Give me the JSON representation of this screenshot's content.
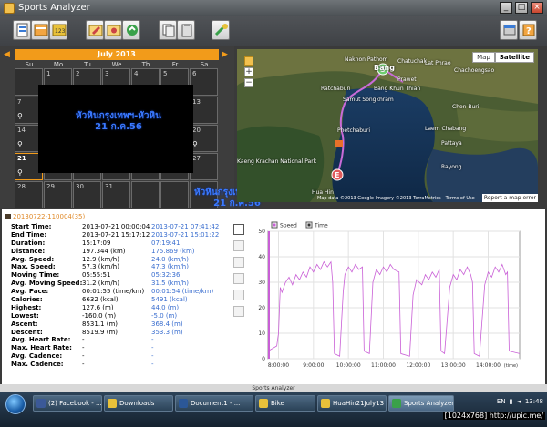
{
  "window": {
    "title": "Sports Analyzer",
    "controls": [
      "_",
      "□",
      "×"
    ]
  },
  "toolbar": {
    "buttons": [
      "new-icon",
      "import-icon",
      "export-icon",
      "edit-icon",
      "gear-icon",
      "refresh-icon",
      "copy-icon",
      "paste-icon",
      "plugin-icon",
      "pin-icon",
      "help-icon"
    ]
  },
  "calendar": {
    "month_label": "July 2013",
    "prev": "◀",
    "next": "▶",
    "weekdays": [
      "Su",
      "Mo",
      "Tu",
      "We",
      "Th",
      "Fr",
      "Sa"
    ],
    "days": [
      {
        "n": "",
        "bike": false
      },
      {
        "n": "1",
        "bike": false
      },
      {
        "n": "2",
        "bike": false
      },
      {
        "n": "3",
        "bike": false
      },
      {
        "n": "4",
        "bike": false
      },
      {
        "n": "5",
        "bike": false
      },
      {
        "n": "6",
        "bike": false
      },
      {
        "n": "7",
        "bike": true
      },
      {
        "n": "8",
        "bike": false
      },
      {
        "n": "9",
        "bike": false
      },
      {
        "n": "10",
        "bike": false
      },
      {
        "n": "11",
        "bike": false
      },
      {
        "n": "12",
        "bike": false
      },
      {
        "n": "13",
        "bike": false
      },
      {
        "n": "14",
        "bike": true
      },
      {
        "n": "15",
        "bike": false
      },
      {
        "n": "16",
        "bike": false
      },
      {
        "n": "17",
        "bike": false
      },
      {
        "n": "18",
        "bike": false
      },
      {
        "n": "19",
        "bike": false
      },
      {
        "n": "20",
        "bike": true
      },
      {
        "n": "21",
        "bike": true,
        "selected": true
      },
      {
        "n": "22",
        "bike": false
      },
      {
        "n": "23",
        "bike": false
      },
      {
        "n": "24",
        "bike": false
      },
      {
        "n": "25",
        "bike": false
      },
      {
        "n": "26",
        "bike": false
      },
      {
        "n": "27",
        "bike": false
      },
      {
        "n": "28",
        "bike": false
      },
      {
        "n": "29",
        "bike": false
      },
      {
        "n": "30",
        "bike": false
      },
      {
        "n": "31",
        "bike": false
      },
      {
        "n": "",
        "bike": false
      },
      {
        "n": "",
        "bike": false
      },
      {
        "n": "",
        "bike": false
      }
    ],
    "overlay_text_1": "หัวหินกรุงเทพฯ-หัวหิน",
    "overlay_date_1": "21 ก.ค.56",
    "overlay_text_2": "หัวหินกรุงเทพฯ-หัวหิน",
    "overlay_date_2": "21 ก.ค.56"
  },
  "map": {
    "type_buttons": [
      "Map",
      "Satellite"
    ],
    "active_type": "Satellite",
    "zoom_in": "+",
    "zoom_out": "−",
    "places": [
      {
        "name": "Nakhon Pathom",
        "big": false
      },
      {
        "name": "Bang",
        "big": true
      },
      {
        "name": "Chatuchak",
        "big": false
      },
      {
        "name": "Lat Phrao",
        "big": false
      },
      {
        "name": "Chachoengsao",
        "big": false
      },
      {
        "name": "Ratchaburi",
        "big": false
      },
      {
        "name": "Prawet",
        "big": false
      },
      {
        "name": "Bang Khun Thian",
        "big": false
      },
      {
        "name": "Samut Songkhram",
        "big": false
      },
      {
        "name": "Chon Buri",
        "big": false
      },
      {
        "name": "Kaeng Krachan National Park",
        "big": false
      },
      {
        "name": "Laem Chabang",
        "big": false
      },
      {
        "name": "Phetchaburi",
        "big": false
      },
      {
        "name": "Pattaya",
        "big": false
      },
      {
        "name": "Rayong",
        "big": false
      },
      {
        "name": "Hua Hin",
        "big": false
      }
    ],
    "marker_start": "S",
    "marker_end": "E",
    "footer": "Map data ©2013 Google Imagery ©2013 TerraMetrics - Terms of Use",
    "report": "Report a map error",
    "route_color": "#c96bd8"
  },
  "activity": {
    "id": "20130722-110004(35)",
    "stats": [
      {
        "k": "Start Time:",
        "v": "2013-07-21 00:00:04",
        "v2": "2013-07-21 07:41:42"
      },
      {
        "k": "End Time:",
        "v": "2013-07-21 15:17:12",
        "v2": "2013-07-21 15:01:22"
      },
      {
        "k": "Duration:",
        "v": "15:17:09",
        "v2": "07:19:41"
      },
      {
        "k": "Distance:",
        "v": "197.344 (km)",
        "v2": "175.869 (km)"
      },
      {
        "k": "Avg. Speed:",
        "v": "12.9 (km/h)",
        "v2": "24.0 (km/h)"
      },
      {
        "k": "Max. Speed:",
        "v": "57.3 (km/h)",
        "v2": "47.3 (km/h)"
      },
      {
        "k": "Moving Time:",
        "v": "05:55:51",
        "v2": "05:32:36"
      },
      {
        "k": "Avg. Moving Speed:",
        "v": "31.2 (km/h)",
        "v2": "31.5 (km/h)"
      },
      {
        "k": "Avg. Pace:",
        "v": "00:01:55 (time/km)",
        "v2": "00:01:54 (time/km)"
      },
      {
        "k": "Calories:",
        "v": "6632 (kcal)",
        "v2": "5491 (kcal)"
      },
      {
        "k": "Highest:",
        "v": "127.6 (m)",
        "v2": "44.0 (m)"
      },
      {
        "k": "Lowest:",
        "v": "-160.0 (m)",
        "v2": "-5.0 (m)"
      },
      {
        "k": "Ascent:",
        "v": "8531.1 (m)",
        "v2": "368.4 (m)"
      },
      {
        "k": "Descent:",
        "v": "8519.9 (m)",
        "v2": "353.3 (m)"
      },
      {
        "k": "Avg. Heart Rate:",
        "v": "-",
        "v2": "-"
      },
      {
        "k": "Max. Heart Rate:",
        "v": "-",
        "v2": "-"
      },
      {
        "k": "Avg. Cadence:",
        "v": "-",
        "v2": "-"
      },
      {
        "k": "Max. Cadence:",
        "v": "-",
        "v2": "-"
      }
    ]
  },
  "chart_data": {
    "type": "line",
    "legend": [
      {
        "name": "Speed",
        "checked": true
      },
      {
        "name": "Time",
        "checked": true
      }
    ],
    "ylim": [
      0,
      50
    ],
    "yticks": [
      "50",
      "40",
      "30",
      "20",
      "10",
      "0"
    ],
    "xticks": [
      "8:00:00",
      "9:00:00",
      "10:00:00",
      "11:00:00",
      "12:00:00",
      "13:00:00",
      "14:00:00"
    ],
    "xlabel": "(time)",
    "xlim_hours": [
      7.7,
      14.9
    ],
    "line_color": "#c95fd6",
    "series": [
      {
        "points": [
          [
            7.7,
            3
          ],
          [
            7.95,
            5
          ],
          [
            8.0,
            10
          ],
          [
            8.05,
            28
          ],
          [
            8.1,
            26
          ],
          [
            8.2,
            30
          ],
          [
            8.3,
            32
          ],
          [
            8.4,
            29
          ],
          [
            8.5,
            33
          ],
          [
            8.6,
            31
          ],
          [
            8.7,
            34
          ],
          [
            8.8,
            32
          ],
          [
            8.9,
            36
          ],
          [
            9.0,
            34
          ],
          [
            9.1,
            37
          ],
          [
            9.2,
            35
          ],
          [
            9.3,
            38
          ],
          [
            9.4,
            36
          ],
          [
            9.5,
            38
          ],
          [
            9.55,
            30
          ],
          [
            9.6,
            2
          ],
          [
            9.75,
            1
          ],
          [
            9.85,
            26
          ],
          [
            9.9,
            33
          ],
          [
            10.0,
            36
          ],
          [
            10.1,
            34
          ],
          [
            10.2,
            37
          ],
          [
            10.3,
            35
          ],
          [
            10.4,
            36
          ],
          [
            10.45,
            3
          ],
          [
            10.6,
            2
          ],
          [
            10.7,
            30
          ],
          [
            10.8,
            35
          ],
          [
            10.9,
            33
          ],
          [
            11.0,
            36
          ],
          [
            11.1,
            34
          ],
          [
            11.2,
            37
          ],
          [
            11.3,
            35
          ],
          [
            11.45,
            34
          ],
          [
            11.5,
            2
          ],
          [
            11.75,
            1
          ],
          [
            11.85,
            25
          ],
          [
            11.95,
            31
          ],
          [
            12.1,
            29
          ],
          [
            12.2,
            33
          ],
          [
            12.3,
            31
          ],
          [
            12.4,
            34
          ],
          [
            12.5,
            32
          ],
          [
            12.6,
            35
          ],
          [
            12.65,
            3
          ],
          [
            12.75,
            2
          ],
          [
            12.9,
            28
          ],
          [
            13.0,
            33
          ],
          [
            13.1,
            31
          ],
          [
            13.2,
            35
          ],
          [
            13.3,
            33
          ],
          [
            13.4,
            36
          ],
          [
            13.5,
            33
          ],
          [
            13.55,
            30
          ],
          [
            13.6,
            2
          ],
          [
            13.75,
            1
          ],
          [
            13.9,
            29
          ],
          [
            14.0,
            34
          ],
          [
            14.1,
            32
          ],
          [
            14.2,
            36
          ],
          [
            14.3,
            34
          ],
          [
            14.4,
            37
          ],
          [
            14.5,
            33
          ],
          [
            14.55,
            34
          ],
          [
            14.6,
            3
          ],
          [
            14.9,
            2
          ]
        ]
      }
    ]
  },
  "status_bar": {
    "text": "Sports Analyzer"
  },
  "taskbar": {
    "tasks": [
      {
        "label": "(2) Facebook - ...",
        "color": "#3b5998",
        "active": false
      },
      {
        "label": "Downloads",
        "color": "#e8c13a",
        "active": false
      },
      {
        "label": "Document1 - ...",
        "color": "#2b5797",
        "active": false
      },
      {
        "label": "Bike",
        "color": "#e8c13a",
        "active": false
      },
      {
        "label": "HuaHin21July13",
        "color": "#e8c13a",
        "active": false
      },
      {
        "label": "Sports Analyzer",
        "color": "#3aa14a",
        "active": true
      }
    ],
    "clock": "13:48",
    "lang": "EN"
  },
  "watermark": "[1024x768] http://upic.me/"
}
